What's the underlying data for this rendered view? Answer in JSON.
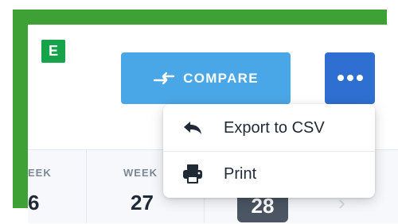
{
  "badge": {
    "label": "E",
    "color": "#16a34a"
  },
  "toolbar": {
    "compare_label": "COMPARE",
    "compare_icon": "compare-arrows-icon",
    "more_icon": "more-horizontal-icon",
    "compare_color": "#4aa7e7",
    "more_color": "#2e6fd1"
  },
  "menu": {
    "items": [
      {
        "label": "Export to CSV",
        "icon": "reply-arrow-icon"
      },
      {
        "label": "Print",
        "icon": "printer-icon"
      }
    ]
  },
  "weeks": [
    {
      "label": "EEK",
      "number": "6"
    },
    {
      "label": "WEEK",
      "number": "27"
    },
    {
      "label": "",
      "number": "28",
      "selected": true
    }
  ],
  "highlight_color": "#3ea135"
}
